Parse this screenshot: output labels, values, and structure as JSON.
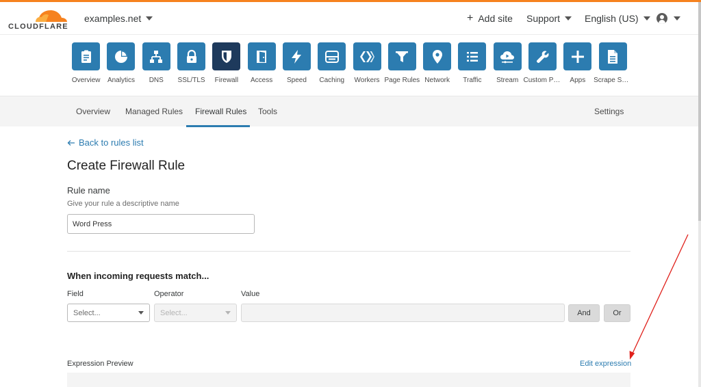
{
  "brand": {
    "logo_text": "CLOUDFLARE",
    "accent_color": "#f6821f",
    "primary_color": "#2c7cb0",
    "active_tile_color": "#1e3a5c"
  },
  "header": {
    "site": "examples.net",
    "add_site": "Add site",
    "support": "Support",
    "language": "English (US)",
    "user_icon": "user-circle-icon"
  },
  "apps": [
    {
      "label": "Overview",
      "icon": "clipboard-icon"
    },
    {
      "label": "Analytics",
      "icon": "pie-chart-icon"
    },
    {
      "label": "DNS",
      "icon": "network-tree-icon"
    },
    {
      "label": "SSL/TLS",
      "icon": "lock-icon"
    },
    {
      "label": "Firewall",
      "icon": "shield-icon",
      "active": true
    },
    {
      "label": "Access",
      "icon": "door-icon"
    },
    {
      "label": "Speed",
      "icon": "lightning-icon"
    },
    {
      "label": "Caching",
      "icon": "server-icon"
    },
    {
      "label": "Workers",
      "icon": "workers-icon"
    },
    {
      "label": "Page Rules",
      "icon": "filter-icon"
    },
    {
      "label": "Network",
      "icon": "location-pin-icon"
    },
    {
      "label": "Traffic",
      "icon": "list-icon"
    },
    {
      "label": "Stream",
      "icon": "cloud-play-icon"
    },
    {
      "label": "Custom Pa...",
      "icon": "wrench-icon"
    },
    {
      "label": "Apps",
      "icon": "plus-icon"
    },
    {
      "label": "Scrape Shi...",
      "icon": "document-icon"
    }
  ],
  "subnav": {
    "tabs": [
      "Overview",
      "Managed Rules",
      "Firewall Rules",
      "Tools"
    ],
    "active": "Firewall Rules",
    "settings": "Settings"
  },
  "content": {
    "back_link": "Back to rules list",
    "title": "Create Firewall Rule",
    "rule_name_label": "Rule name",
    "rule_name_help": "Give your rule a descriptive name",
    "rule_name_value": "Word Press",
    "match_title": "When incoming requests match...",
    "field_label": "Field",
    "operator_label": "Operator",
    "value_label": "Value",
    "field_placeholder": "Select...",
    "operator_placeholder": "Select...",
    "and_button": "And",
    "or_button": "Or",
    "preview_label": "Expression Preview",
    "edit_expression": "Edit expression"
  }
}
